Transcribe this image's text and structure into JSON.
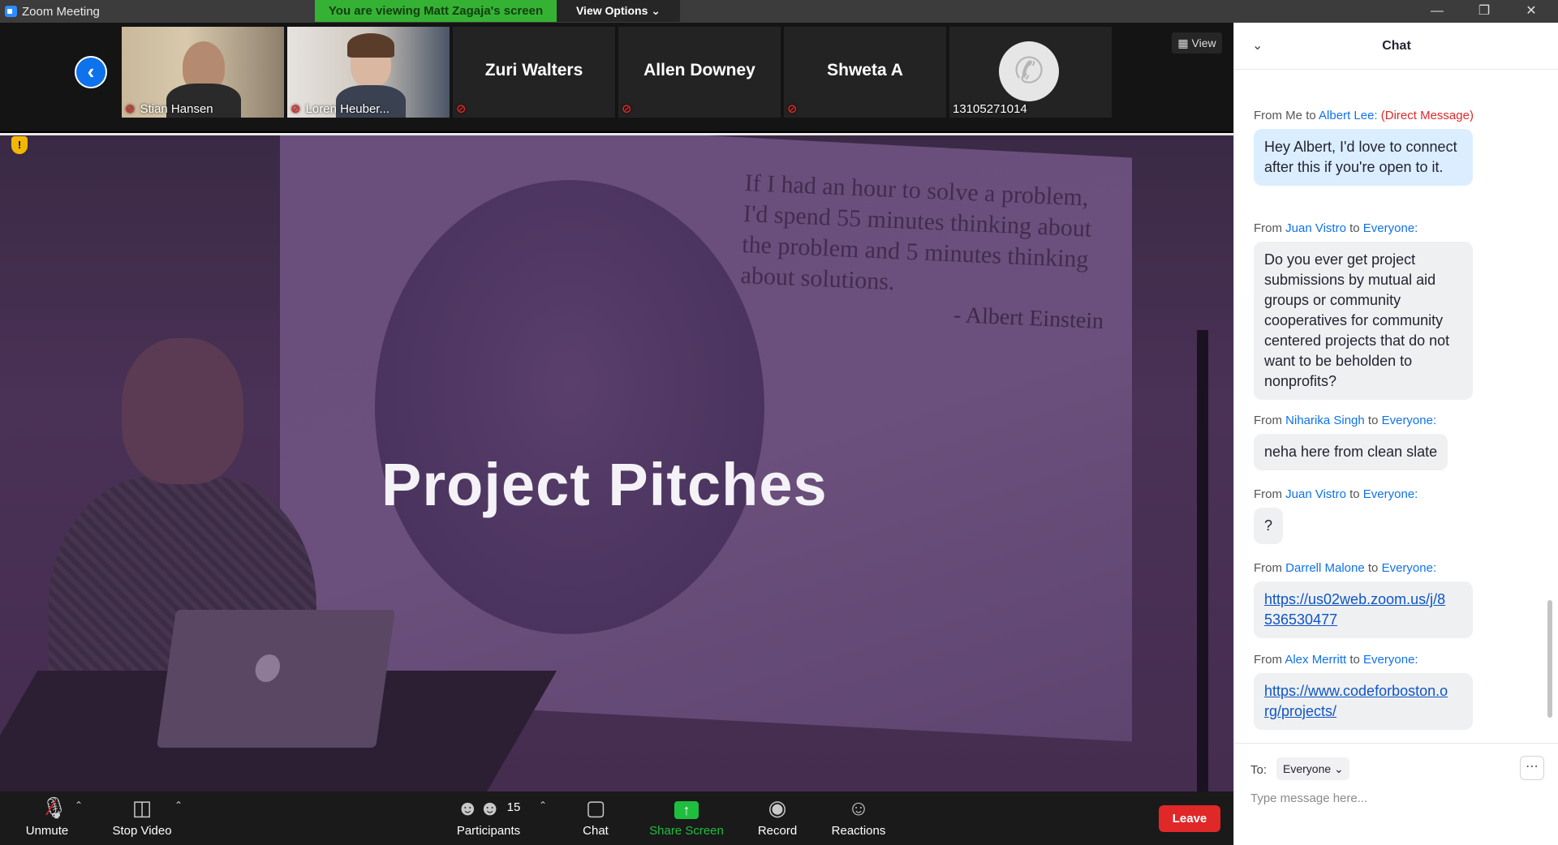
{
  "window": {
    "title": "Zoom Meeting",
    "viewing_banner": "You are viewing Matt Zagaja's screen",
    "view_options": "View Options ⌄"
  },
  "gallery": {
    "view_label": "View",
    "tiles": [
      {
        "name": "Stian Hansen"
      },
      {
        "name": "Loren Heuber..."
      },
      {
        "name": "Zuri Walters"
      },
      {
        "name": "Allen Downey"
      },
      {
        "name": "Shweta A"
      },
      {
        "name": "13105271014"
      }
    ]
  },
  "slide": {
    "quote": "If I had an hour to solve a problem, I'd spend 55 minutes thinking about the problem and 5 minutes thinking about solutions.",
    "attribution": "- Albert Einstein",
    "title": "Project Pitches"
  },
  "toolbar": {
    "unmute": "Unmute",
    "stop_video": "Stop Video",
    "participants": "Participants",
    "participants_count": "15",
    "chat": "Chat",
    "share_screen": "Share Screen",
    "record": "Record",
    "reactions": "Reactions",
    "leave": "Leave",
    "share_color": "#1fbe3f",
    "leave_color": "#e02828"
  },
  "chat": {
    "title": "Chat",
    "messages": [
      {
        "from": "Me",
        "to": "Albert Lee:",
        "dm": "(Direct Message)",
        "text": "Hey Albert, I'd love to connect after this if you're open to it."
      },
      {
        "from": "Juan Vistro",
        "to": "Everyone:",
        "text": "Do you ever get project submissions by mutual aid groups or community cooperatives for community centered projects that do not want to be beholden to nonprofits?"
      },
      {
        "from": "Niharika Singh",
        "to": "Everyone:",
        "text": "neha here from clean slate"
      },
      {
        "from": "Juan Vistro",
        "to": "Everyone:",
        "text": "?"
      },
      {
        "from": "Darrell Malone",
        "to": "Everyone:",
        "text": "https://us02web.zoom.us/j/8 536530477"
      },
      {
        "from": "Alex Merritt",
        "to": "Everyone:",
        "text": "https://www.codeforboston.o rg/projects/"
      }
    ],
    "from_word": "From",
    "to_word": "to",
    "to_label": "To:",
    "recipient": "Everyone",
    "input_placeholder": "Type message here..."
  }
}
